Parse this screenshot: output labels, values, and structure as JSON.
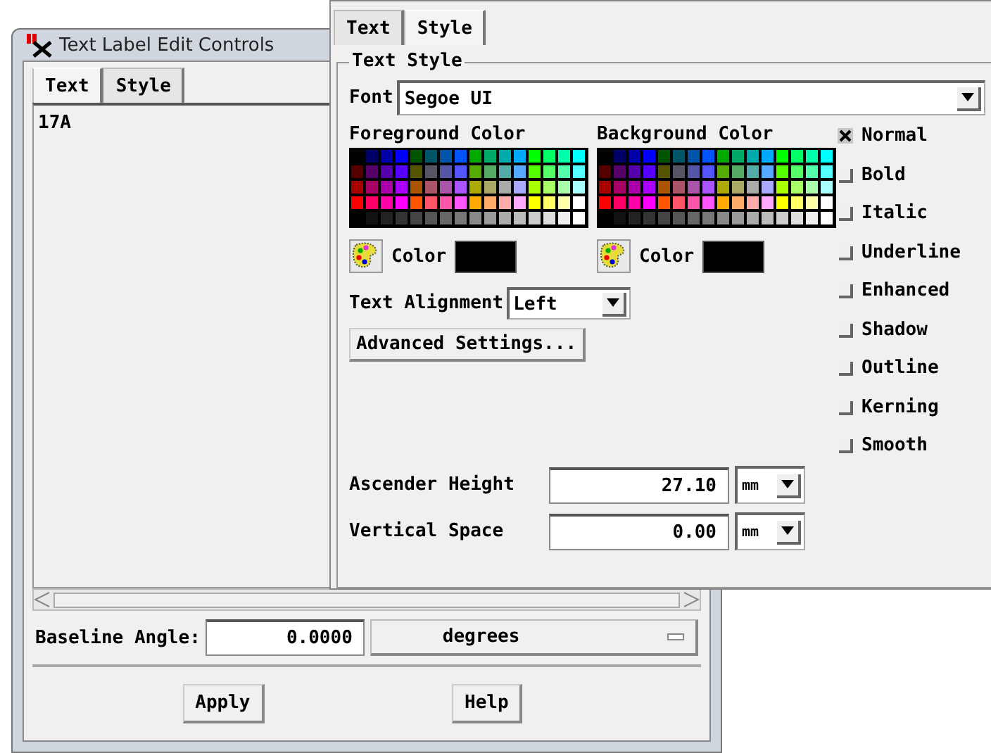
{
  "back_window": {
    "title": "Text Label Edit Controls",
    "tabs": [
      {
        "label": "Text",
        "selected": true
      },
      {
        "label": "Style",
        "selected": false
      }
    ],
    "text_value": "17A",
    "baseline_angle": {
      "label": "Baseline Angle:",
      "value": "0.0000",
      "unit": "degrees"
    },
    "buttons": [
      "Apply",
      "Help"
    ]
  },
  "front_window": {
    "tabs": [
      {
        "label": "Text",
        "selected": false
      },
      {
        "label": "Style",
        "selected": true
      }
    ],
    "group_title": "Text Style",
    "font": {
      "label": "Font",
      "value": "Segoe UI"
    },
    "palettes": [
      {
        "title": "Foreground Color",
        "color_label": "Color",
        "color": "#000000"
      },
      {
        "title": "Background Color",
        "color_label": "Color",
        "color": "#000000"
      }
    ],
    "alignment": {
      "label": "Text Alignment",
      "value": "Left"
    },
    "advanced_button": "Advanced Settings...",
    "styles": [
      {
        "label": "Normal",
        "checked": true
      },
      {
        "label": "Bold",
        "checked": false
      },
      {
        "label": "Italic",
        "checked": false
      },
      {
        "label": "Underline",
        "checked": false
      },
      {
        "label": "Enhanced",
        "checked": false
      },
      {
        "label": "Shadow",
        "checked": false
      },
      {
        "label": "Outline",
        "checked": false
      },
      {
        "label": "Kerning",
        "checked": false
      },
      {
        "label": "Smooth",
        "checked": false
      }
    ],
    "measures": [
      {
        "label": "Ascender Height",
        "value": "27.10",
        "unit": "mm"
      },
      {
        "label": "Vertical Space",
        "value": "0.00",
        "unit": "mm"
      }
    ]
  }
}
